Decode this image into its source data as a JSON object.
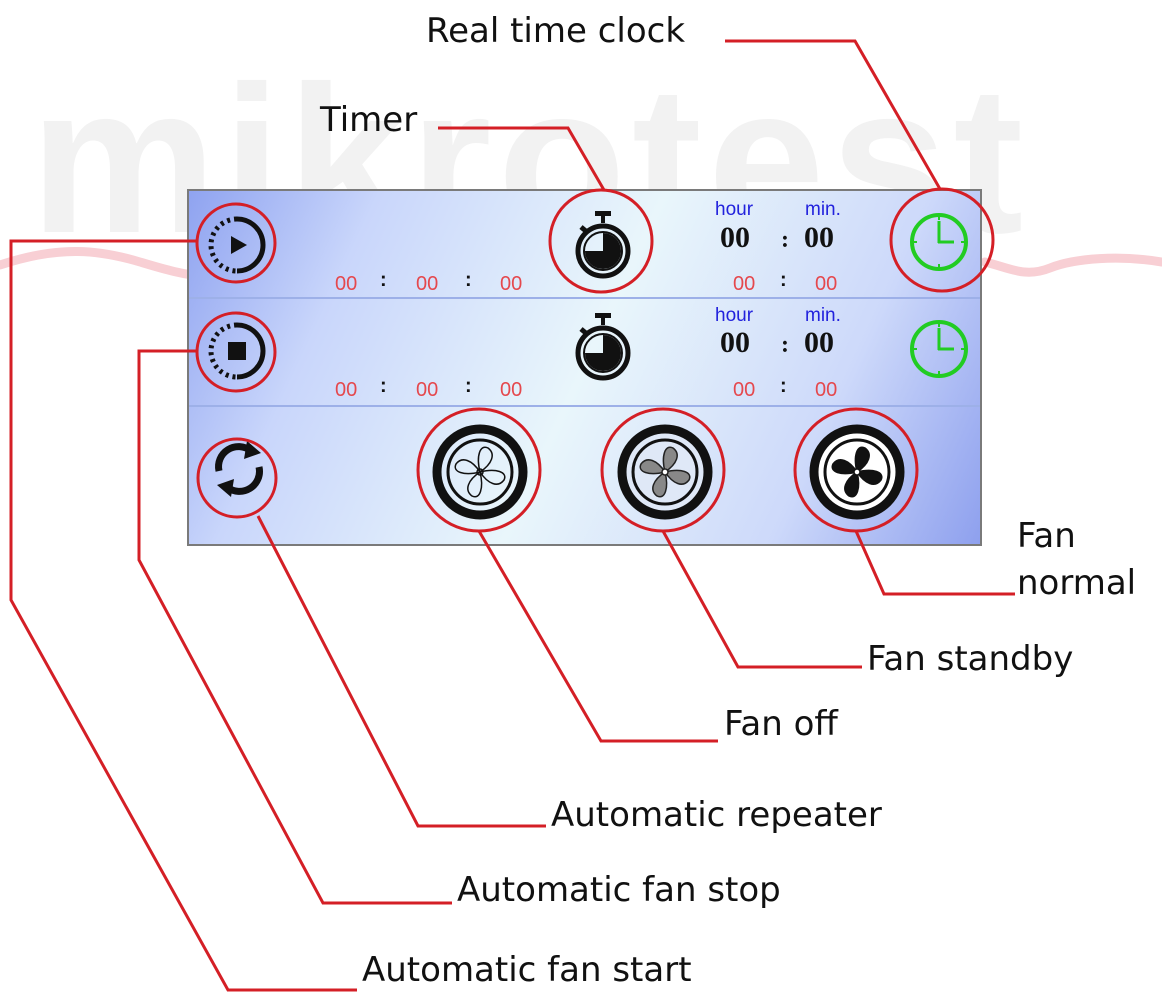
{
  "watermark": "mikrotest",
  "row1": {
    "hour_label": "hour",
    "min_label": "min.",
    "time_hour": "00",
    "time_sep": ":",
    "time_min": "00",
    "count_h": "00",
    "count_m": "00",
    "count_s": "00",
    "count_sep": ":",
    "set_h": "00",
    "set_m": "00"
  },
  "row2": {
    "hour_label": "hour",
    "min_label": "min.",
    "time_hour": "00",
    "time_sep": ":",
    "time_min": "00",
    "count_h": "00",
    "count_m": "00",
    "count_s": "00",
    "count_sep": ":",
    "set_h": "00",
    "set_m": "00"
  },
  "callouts": {
    "real_time_clock": "Real time clock",
    "timer": "Timer",
    "fan": "Fan",
    "normal": "normal",
    "fan_standby": "Fan standby",
    "fan_off": "Fan off",
    "automatic_repeater": "Automatic repeater",
    "automatic_fan_stop": "Automatic fan stop",
    "automatic_fan_start": "Automatic fan start"
  },
  "colors": {
    "callout_line": "#d41f26",
    "clock_icon": "#22cc22",
    "value_text": "#e5484d",
    "label_text": "#2222dd"
  },
  "icons": [
    "play-circle-icon",
    "stop-circle-icon",
    "refresh-icon",
    "stopwatch-icon",
    "clock-icon",
    "fan-off-icon",
    "fan-standby-icon",
    "fan-normal-icon"
  ]
}
